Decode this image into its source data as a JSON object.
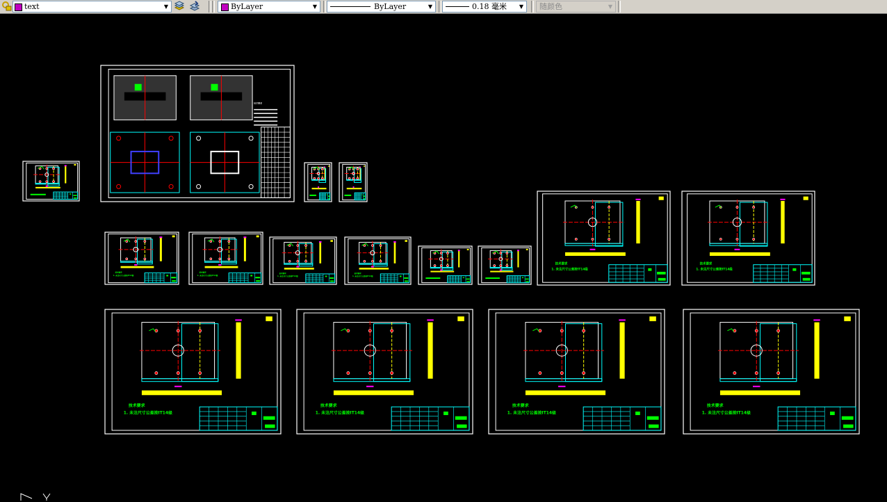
{
  "toolbar": {
    "layer": {
      "name": "text",
      "color": "#c000c0",
      "icons": [
        "layer-state-icon",
        "layer-color-icon"
      ]
    },
    "layer_tools": [
      "make-current-layer-icon",
      "layer-previous-icon"
    ],
    "color": {
      "value": "ByLayer",
      "swatch": "#c000c0"
    },
    "linetype": {
      "value": "ByLayer"
    },
    "lineweight": {
      "value": "0.18 毫米"
    },
    "plotstyle": {
      "value": "随颜色",
      "disabled": true
    }
  },
  "drawing": {
    "background": "#000000",
    "sheet_notes": {
      "heading": "技术要求",
      "note": "1. 未注尺寸公差按IT14级"
    },
    "colors": {
      "frame": "#ffffff",
      "titleblock": "#00ffff",
      "centerline": "#ff0000",
      "hatch": "#ffff00",
      "text": "#00ff00",
      "dimension": "#ff00ff"
    }
  }
}
